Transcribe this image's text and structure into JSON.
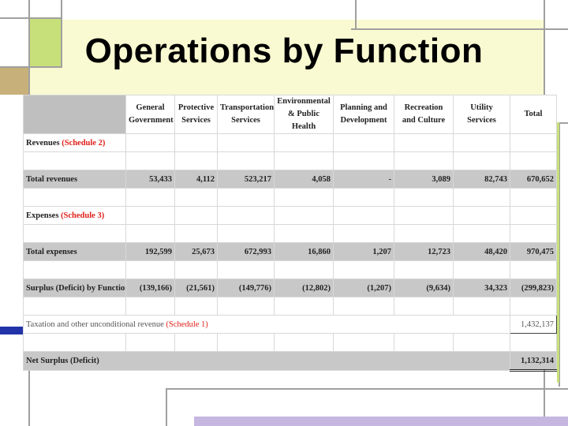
{
  "slide": {
    "title": "Operations by Function"
  },
  "table": {
    "columns": [
      "General Government",
      "Protective Services",
      "Transportation Services",
      "Environmental & Public Health",
      "Planning and Development",
      "Recreation and Culture",
      "Utility Services",
      "Total"
    ],
    "revenues_label": "Revenues ",
    "revenues_schedule": "(Schedule 2)",
    "total_revenues": {
      "label": "Total revenues",
      "values": [
        "53,433",
        "4,112",
        "523,217",
        "4,058",
        "-",
        "3,089",
        "82,743",
        "670,652"
      ]
    },
    "expenses_label": "Expenses ",
    "expenses_schedule": "(Schedule 3)",
    "total_expenses": {
      "label": "Total expenses",
      "values": [
        "192,599",
        "25,673",
        "672,993",
        "16,860",
        "1,207",
        "12,723",
        "48,420",
        "970,475"
      ]
    },
    "surplus": {
      "label": "Surplus (Deficit) by Function",
      "values": [
        "(139,166)",
        "(21,561)",
        "(149,776)",
        "(12,802)",
        "(1,207)",
        "(9,634)",
        "34,323",
        "(299,823)"
      ]
    },
    "taxation": {
      "label": "Taxation and other unconditional revenue ",
      "schedule": "(Schedule 1)",
      "total": "1,432,137"
    },
    "net_surplus": {
      "label": "Net Surplus (Deficit)",
      "total": "1,132,314"
    }
  },
  "colors": {
    "frame_yellow": "#fafad2",
    "frame_green": "#c7e07a",
    "frame_purple": "#c5b7e0",
    "frame_gray": "#a0a0a0",
    "frame_blue": "#2233aa",
    "row_gray": "#c8c8c8",
    "schedule_red": "#e0201a"
  }
}
